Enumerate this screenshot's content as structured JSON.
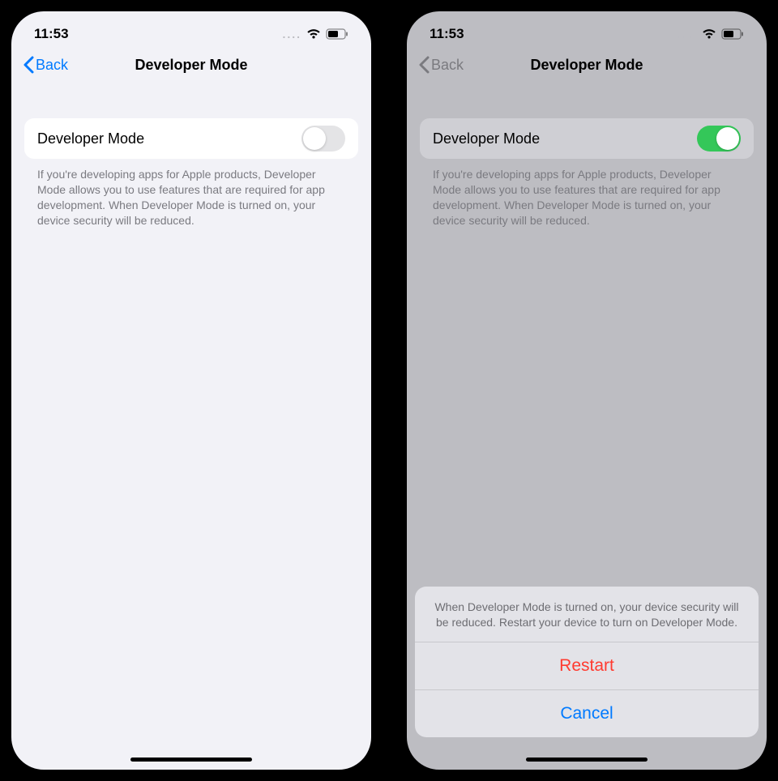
{
  "status": {
    "time": "11:53",
    "cellular": "....",
    "wifi_icon": "wifi",
    "battery_icon": "battery-half"
  },
  "nav": {
    "back_label": "Back",
    "title": "Developer Mode"
  },
  "row": {
    "label": "Developer Mode"
  },
  "footer": "If you're developing apps for Apple products, Developer Mode allows you to use features that are required for app development. When Developer Mode is turned on, your device security will be reduced.",
  "sheet": {
    "message": "When Developer Mode is turned on, your device security will be reduced. Restart your device to turn on Developer Mode.",
    "restart": "Restart",
    "cancel": "Cancel"
  }
}
